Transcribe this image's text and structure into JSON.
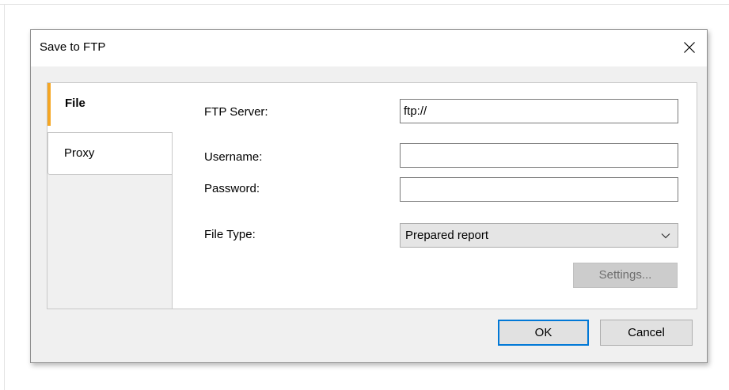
{
  "dialog": {
    "title": "Save to FTP",
    "close_icon": "close-icon"
  },
  "tabs": [
    {
      "label": "File",
      "active": true
    },
    {
      "label": "Proxy",
      "active": false
    }
  ],
  "form": {
    "ftp_server_label": "FTP Server:",
    "ftp_server_value": "ftp://",
    "username_label": "Username:",
    "username_value": "",
    "password_label": "Password:",
    "password_value": "",
    "file_type_label": "File Type:",
    "file_type_value": "Prepared report",
    "dropdown_icon": "chevron-down-icon"
  },
  "buttons": {
    "settings": "Settings...",
    "ok": "OK",
    "cancel": "Cancel"
  },
  "colors": {
    "active_tab_accent": "#f5a623",
    "focus_border": "#0078d7"
  }
}
